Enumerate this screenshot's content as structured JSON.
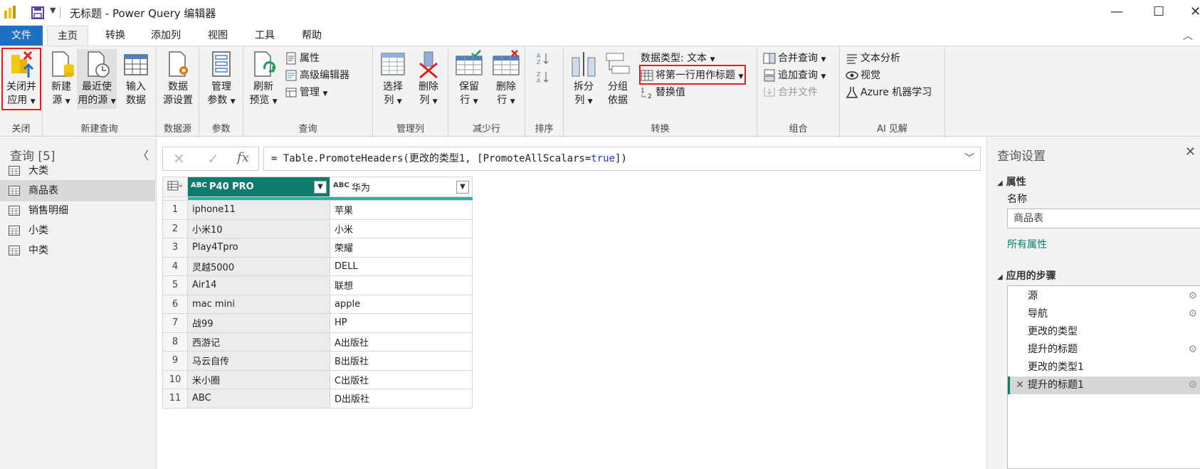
{
  "titlebar": {
    "title": "无标题 - Power Query 编辑器",
    "minimize": "—",
    "maximize": "☐",
    "close": "✕"
  },
  "tabs": {
    "file": "文件",
    "home": "主页",
    "transform": "转换",
    "add_column": "添加列",
    "view": "视图",
    "tools": "工具",
    "help": "帮助"
  },
  "ribbon": {
    "close_apply": [
      "关闭并",
      "应用"
    ],
    "new_source": [
      "新建",
      "源"
    ],
    "recent_sources": [
      "最近使",
      "用的源"
    ],
    "enter_data": [
      "输入",
      "数据"
    ],
    "data_source_settings": [
      "数据",
      "源设置"
    ],
    "manage_params": [
      "管理",
      "参数"
    ],
    "refresh_preview": [
      "刷新",
      "预览"
    ],
    "properties": "属性",
    "advanced_editor": "高级编辑器",
    "manage": "管理",
    "choose_columns": [
      "选择",
      "列"
    ],
    "remove_columns": [
      "删除",
      "列"
    ],
    "keep_rows": [
      "保留",
      "行"
    ],
    "remove_rows": [
      "删除",
      "行"
    ],
    "split_column": [
      "拆分",
      "列"
    ],
    "group_by": [
      "分组",
      "依据"
    ],
    "data_type": "数据类型: 文本",
    "use_first_row": "将第一行用作标题",
    "replace_values": "替换值",
    "merge_queries": "合并查询",
    "append_queries": "追加查询",
    "combine_files": "合并文件",
    "text_analytics": "文本分析",
    "vision": "视觉",
    "azure_ml": "Azure 机器学习",
    "groups": {
      "close": "关闭",
      "new_query": "新建查询",
      "data_sources": "数据源",
      "parameters": "参数",
      "query": "查询",
      "manage_columns": "管理列",
      "reduce_rows": "减少行",
      "sort": "排序",
      "transform": "转换",
      "combine": "组合",
      "ai_insights": "AI 见解"
    }
  },
  "queries": {
    "header": "查询 [5]",
    "items": [
      "大类",
      "商品表",
      "销售明细",
      "小类",
      "中类"
    ],
    "selected": "商品表"
  },
  "formula": {
    "cancel": "✕",
    "commit": "✓",
    "fx": "fx",
    "prefix": "= Table.PromoteHeaders(更改的类型1, [PromoteAllScalars=",
    "keyword": "true",
    "suffix": "])"
  },
  "grid": {
    "type_icon": "ABC",
    "columns": [
      "P40 PRO",
      "华为"
    ],
    "rows": [
      [
        "1",
        "iphone11",
        "苹果"
      ],
      [
        "2",
        "小米10",
        "小米"
      ],
      [
        "3",
        "Play4Tpro",
        "荣耀"
      ],
      [
        "4",
        "灵越5000",
        "DELL"
      ],
      [
        "5",
        "Air14",
        "联想"
      ],
      [
        "6",
        "mac mini",
        "apple"
      ],
      [
        "7",
        "战99",
        "HP"
      ],
      [
        "8",
        "西游记",
        "A出版社"
      ],
      [
        "9",
        "马云自传",
        "B出版社"
      ],
      [
        "10",
        "米小圈",
        "C出版社"
      ],
      [
        "11",
        "ABC",
        "D出版社"
      ]
    ]
  },
  "settings": {
    "header": "查询设置",
    "properties": "属性",
    "name_label": "名称",
    "name_value": "商品表",
    "all_properties": "所有属性",
    "applied_steps": "应用的步骤",
    "steps": [
      "源",
      "导航",
      "更改的类型",
      "提升的标题",
      "更改的类型1",
      "提升的标题1"
    ]
  },
  "colors": {
    "file_tab": "#1f6fc4",
    "header_accent": "#0f7b6c",
    "quality_bar": "#23b89b",
    "highlight_box": "#e02020"
  }
}
